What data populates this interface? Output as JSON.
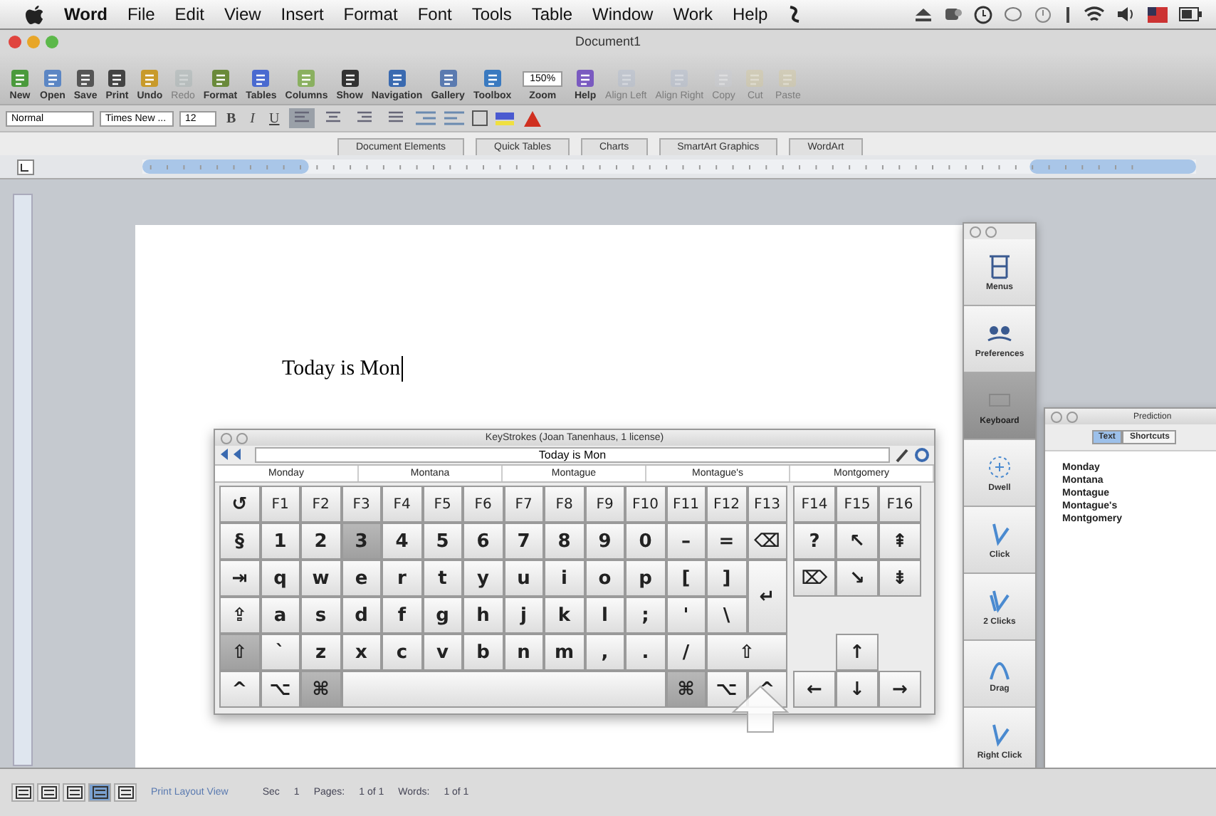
{
  "menubar": {
    "menus": [
      "Word",
      "File",
      "Edit",
      "View",
      "Insert",
      "Format",
      "Font",
      "Tools",
      "Table",
      "Window",
      "Work",
      "Help"
    ]
  },
  "window": {
    "title": "Document1"
  },
  "toolbar": [
    {
      "kind": "button",
      "label": "New",
      "disabled": false
    },
    {
      "kind": "button",
      "label": "Open",
      "disabled": false
    },
    {
      "kind": "button",
      "label": "Save",
      "disabled": false
    },
    {
      "kind": "button",
      "label": "Print",
      "disabled": false
    },
    {
      "kind": "button",
      "label": "Undo",
      "disabled": false
    },
    {
      "kind": "button",
      "label": "Redo",
      "disabled": true
    },
    {
      "kind": "button",
      "label": "Format",
      "disabled": false
    },
    {
      "kind": "button",
      "label": "Tables",
      "disabled": false
    },
    {
      "kind": "button",
      "label": "Columns",
      "disabled": false
    },
    {
      "kind": "button",
      "label": "Show",
      "disabled": false
    },
    {
      "kind": "button",
      "label": "Navigation",
      "disabled": false
    },
    {
      "kind": "button",
      "label": "Gallery",
      "disabled": false
    },
    {
      "kind": "button",
      "label": "Toolbox",
      "disabled": false
    },
    {
      "kind": "zoom",
      "label": "Zoom",
      "value": "150%"
    },
    {
      "kind": "button",
      "label": "Help",
      "disabled": false
    },
    {
      "kind": "button",
      "label": "Align Left",
      "disabled": true
    },
    {
      "kind": "button",
      "label": "Align Right",
      "disabled": true
    },
    {
      "kind": "button",
      "label": "Copy",
      "disabled": true
    },
    {
      "kind": "button",
      "label": "Cut",
      "disabled": true
    },
    {
      "kind": "button",
      "label": "Paste",
      "disabled": true
    }
  ],
  "format_bar": {
    "style": "Normal",
    "font": "Times New ...",
    "size": "12",
    "styles": [
      {
        "label": "B",
        "selected": false
      },
      {
        "label": "I",
        "selected": false
      },
      {
        "label": "U",
        "selected": false
      }
    ],
    "alignments": [
      {
        "selected": true
      },
      {
        "selected": false
      },
      {
        "selected": false
      },
      {
        "selected": false
      }
    ]
  },
  "ribbon_tabs": [
    "Document Elements",
    "Quick Tables",
    "Charts",
    "SmartArt Graphics",
    "WordArt"
  ],
  "document": {
    "text": "Today is Mon"
  },
  "keyboard": {
    "title": "KeyStrokes (Joan Tanenhaus, 1 license)",
    "input": "Today is Mon",
    "predictions": [
      "Monday",
      "Montana",
      "Montague",
      "Montague's",
      "Montgomery"
    ],
    "rows": [
      {
        "main": [
          {
            "kind": "key",
            "label": "↺",
            "pressed": false
          },
          {
            "kind": "fkey",
            "label": "F1",
            "pressed": false
          },
          {
            "kind": "fkey",
            "label": "F2",
            "pressed": false
          },
          {
            "kind": "fkey",
            "label": "F3",
            "pressed": false
          },
          {
            "kind": "fkey",
            "label": "F4",
            "pressed": false
          },
          {
            "kind": "fkey",
            "label": "F5",
            "pressed": false
          },
          {
            "kind": "fkey",
            "label": "F6",
            "pressed": false
          },
          {
            "kind": "fkey",
            "label": "F7",
            "pressed": false
          },
          {
            "kind": "fkey",
            "label": "F8",
            "pressed": false
          },
          {
            "kind": "fkey",
            "label": "F9",
            "pressed": false
          },
          {
            "kind": "fkey",
            "label": "F10",
            "pressed": false
          },
          {
            "kind": "fkey",
            "label": "F11",
            "pressed": false
          },
          {
            "kind": "fkey",
            "label": "F12",
            "pressed": false
          },
          {
            "kind": "fkey",
            "label": "F13",
            "pressed": false
          }
        ],
        "side": [
          {
            "kind": "fkey",
            "label": "F14",
            "pressed": false
          },
          {
            "kind": "fkey",
            "label": "F15",
            "pressed": false
          },
          {
            "kind": "fkey",
            "label": "F16",
            "pressed": false
          }
        ]
      },
      {
        "main": [
          {
            "kind": "key",
            "label": "§",
            "pressed": false
          },
          {
            "kind": "key",
            "label": "1",
            "pressed": false
          },
          {
            "kind": "key",
            "label": "2",
            "pressed": false
          },
          {
            "kind": "key",
            "label": "3",
            "pressed": true
          },
          {
            "kind": "key",
            "label": "4",
            "pressed": false
          },
          {
            "kind": "key",
            "label": "5",
            "pressed": false
          },
          {
            "kind": "key",
            "label": "6",
            "pressed": false
          },
          {
            "kind": "key",
            "label": "7",
            "pressed": false
          },
          {
            "kind": "key",
            "label": "8",
            "pressed": false
          },
          {
            "kind": "key",
            "label": "9",
            "pressed": false
          },
          {
            "kind": "key",
            "label": "0",
            "pressed": false
          },
          {
            "kind": "key",
            "label": "–",
            "pressed": false
          },
          {
            "kind": "key",
            "label": "=",
            "pressed": false
          },
          {
            "kind": "key",
            "label": "⌫",
            "pressed": false
          }
        ],
        "side": [
          {
            "kind": "key",
            "label": "?",
            "pressed": false
          },
          {
            "kind": "key",
            "label": "↖",
            "pressed": false
          },
          {
            "kind": "key",
            "label": "⇞",
            "pressed": false
          }
        ]
      },
      {
        "main": [
          {
            "kind": "key",
            "label": "⇥",
            "pressed": false
          },
          {
            "kind": "key",
            "label": "q",
            "pressed": false
          },
          {
            "kind": "key",
            "label": "w",
            "pressed": false
          },
          {
            "kind": "key",
            "label": "e",
            "pressed": false
          },
          {
            "kind": "key",
            "label": "r",
            "pressed": false
          },
          {
            "kind": "key",
            "label": "t",
            "pressed": false
          },
          {
            "kind": "key",
            "label": "y",
            "pressed": false
          },
          {
            "kind": "key",
            "label": "u",
            "pressed": false
          },
          {
            "kind": "key",
            "label": "i",
            "pressed": false
          },
          {
            "kind": "key",
            "label": "o",
            "pressed": false
          },
          {
            "kind": "key",
            "label": "p",
            "pressed": false
          },
          {
            "kind": "key",
            "label": "[",
            "pressed": false
          },
          {
            "kind": "key",
            "label": "]",
            "pressed": false
          },
          {
            "kind": "return",
            "label": "↵",
            "pressed": false
          }
        ],
        "side": [
          {
            "kind": "key",
            "label": "⌦",
            "pressed": false
          },
          {
            "kind": "key",
            "label": "↘",
            "pressed": false
          },
          {
            "kind": "key",
            "label": "⇟",
            "pressed": false
          }
        ]
      },
      {
        "main": [
          {
            "kind": "key",
            "label": "⇪",
            "pressed": false
          },
          {
            "kind": "key",
            "label": "a",
            "pressed": false
          },
          {
            "kind": "key",
            "label": "s",
            "pressed": false
          },
          {
            "kind": "key",
            "label": "d",
            "pressed": false
          },
          {
            "kind": "key",
            "label": "f",
            "pressed": false
          },
          {
            "kind": "key",
            "label": "g",
            "pressed": false
          },
          {
            "kind": "key",
            "label": "h",
            "pressed": false
          },
          {
            "kind": "key",
            "label": "j",
            "pressed": false
          },
          {
            "kind": "key",
            "label": "k",
            "pressed": false
          },
          {
            "kind": "key",
            "label": "l",
            "pressed": false
          },
          {
            "kind": "key",
            "label": ";",
            "pressed": false
          },
          {
            "kind": "key",
            "label": "'",
            "pressed": false
          },
          {
            "kind": "key",
            "label": "\\",
            "pressed": false
          }
        ]
      },
      {
        "main": [
          {
            "kind": "key",
            "label": "⇧",
            "pressed": true
          },
          {
            "kind": "key",
            "label": "`",
            "pressed": false
          },
          {
            "kind": "key",
            "label": "z",
            "pressed": false
          },
          {
            "kind": "key",
            "label": "x",
            "pressed": false
          },
          {
            "kind": "key",
            "label": "c",
            "pressed": false
          },
          {
            "kind": "key",
            "label": "v",
            "pressed": false
          },
          {
            "kind": "key",
            "label": "b",
            "pressed": false
          },
          {
            "kind": "key",
            "label": "n",
            "pressed": false
          },
          {
            "kind": "key",
            "label": "m",
            "pressed": false
          },
          {
            "kind": "key",
            "label": ",",
            "pressed": false
          },
          {
            "kind": "key",
            "label": ".",
            "pressed": false
          },
          {
            "kind": "key",
            "label": "/",
            "pressed": false
          },
          {
            "kind": "wide",
            "label": "⇧",
            "pressed": false
          }
        ],
        "side": [
          {
            "kind": "key",
            "label": "↑",
            "pressed": false
          }
        ]
      },
      {
        "main": [
          {
            "kind": "key",
            "label": "^",
            "pressed": false
          },
          {
            "kind": "key",
            "label": "⌥",
            "pressed": false
          },
          {
            "kind": "key",
            "label": "⌘",
            "pressed": true
          },
          {
            "kind": "space",
            "pressed": false
          },
          {
            "kind": "key",
            "label": "⌘",
            "pressed": true
          },
          {
            "kind": "key",
            "label": "⌥",
            "pressed": false
          },
          {
            "kind": "key",
            "label": "^",
            "pressed": false
          }
        ],
        "side": [
          {
            "kind": "key",
            "label": "←",
            "pressed": false
          },
          {
            "kind": "key",
            "label": "↓",
            "pressed": false
          },
          {
            "kind": "key",
            "label": "→",
            "pressed": false
          }
        ]
      }
    ]
  },
  "palette": [
    {
      "label": "Menus",
      "selected": false
    },
    {
      "label": "Preferences",
      "selected": false
    },
    {
      "label": "Keyboard",
      "selected": true
    },
    {
      "label": "Dwell",
      "selected": false
    },
    {
      "label": "Click",
      "selected": false
    },
    {
      "label": "2 Clicks",
      "selected": false
    },
    {
      "label": "Drag",
      "selected": false
    },
    {
      "label": "Right Click",
      "selected": false
    }
  ],
  "prediction_window": {
    "title": "Prediction",
    "tabs": [
      {
        "label": "Text",
        "selected": true
      },
      {
        "label": "Shortcuts",
        "selected": false
      }
    ],
    "words": [
      "Monday",
      "Montana",
      "Montague",
      "Montague's",
      "Montgomery"
    ]
  },
  "status_bar": {
    "view_buttons": [
      {
        "selected": false
      },
      {
        "selected": false
      },
      {
        "selected": false
      },
      {
        "selected": true
      },
      {
        "selected": false
      }
    ],
    "view_name": "Print Layout View",
    "fields": [
      {
        "label": "Sec",
        "value": "1"
      },
      {
        "label": "Pages:",
        "value": "1 of 1"
      },
      {
        "label": "Words:",
        "value": "1 of 1"
      }
    ]
  }
}
